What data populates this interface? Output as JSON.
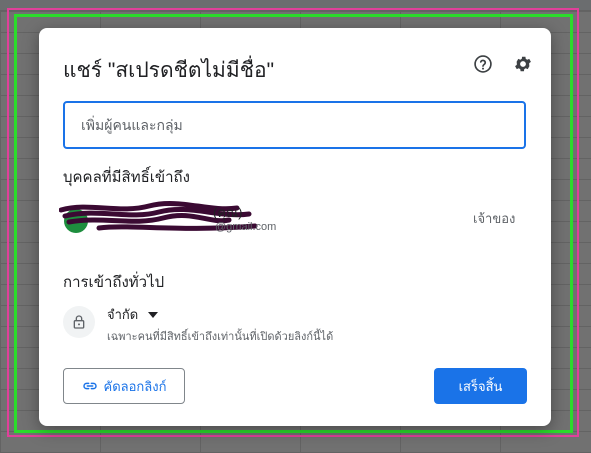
{
  "dialog": {
    "title": "แชร์ \"สเปรดชีตไม่มีชื่อ\"",
    "icons": {
      "help": "help-circle-icon",
      "settings": "gear-icon"
    },
    "people_input": {
      "placeholder": "เพิ่มผู้คนและกลุ่ม",
      "value": ""
    },
    "people_with_access_title": "บุคคลที่มีสิทธิ์เข้าถึง",
    "owner": {
      "name": "(คุณ)",
      "email": "@gmail.com",
      "role": "เจ้าของ"
    },
    "general_access_title": "การเข้าถึงทั่วไป",
    "general_access": {
      "selected": "จำกัด",
      "description": "เฉพาะคนที่มีสิทธิ์เข้าถึงเท่านั้นที่เปิดด้วยลิงก์นี้ได้"
    },
    "copy_link_label": "คัดลอกลิงก์",
    "done_label": "เสร็จสิ้น"
  },
  "colors": {
    "accent": "#1a73e8",
    "overlay_frame_pink": "#e0409a",
    "overlay_frame_green": "#2bdc2b"
  }
}
